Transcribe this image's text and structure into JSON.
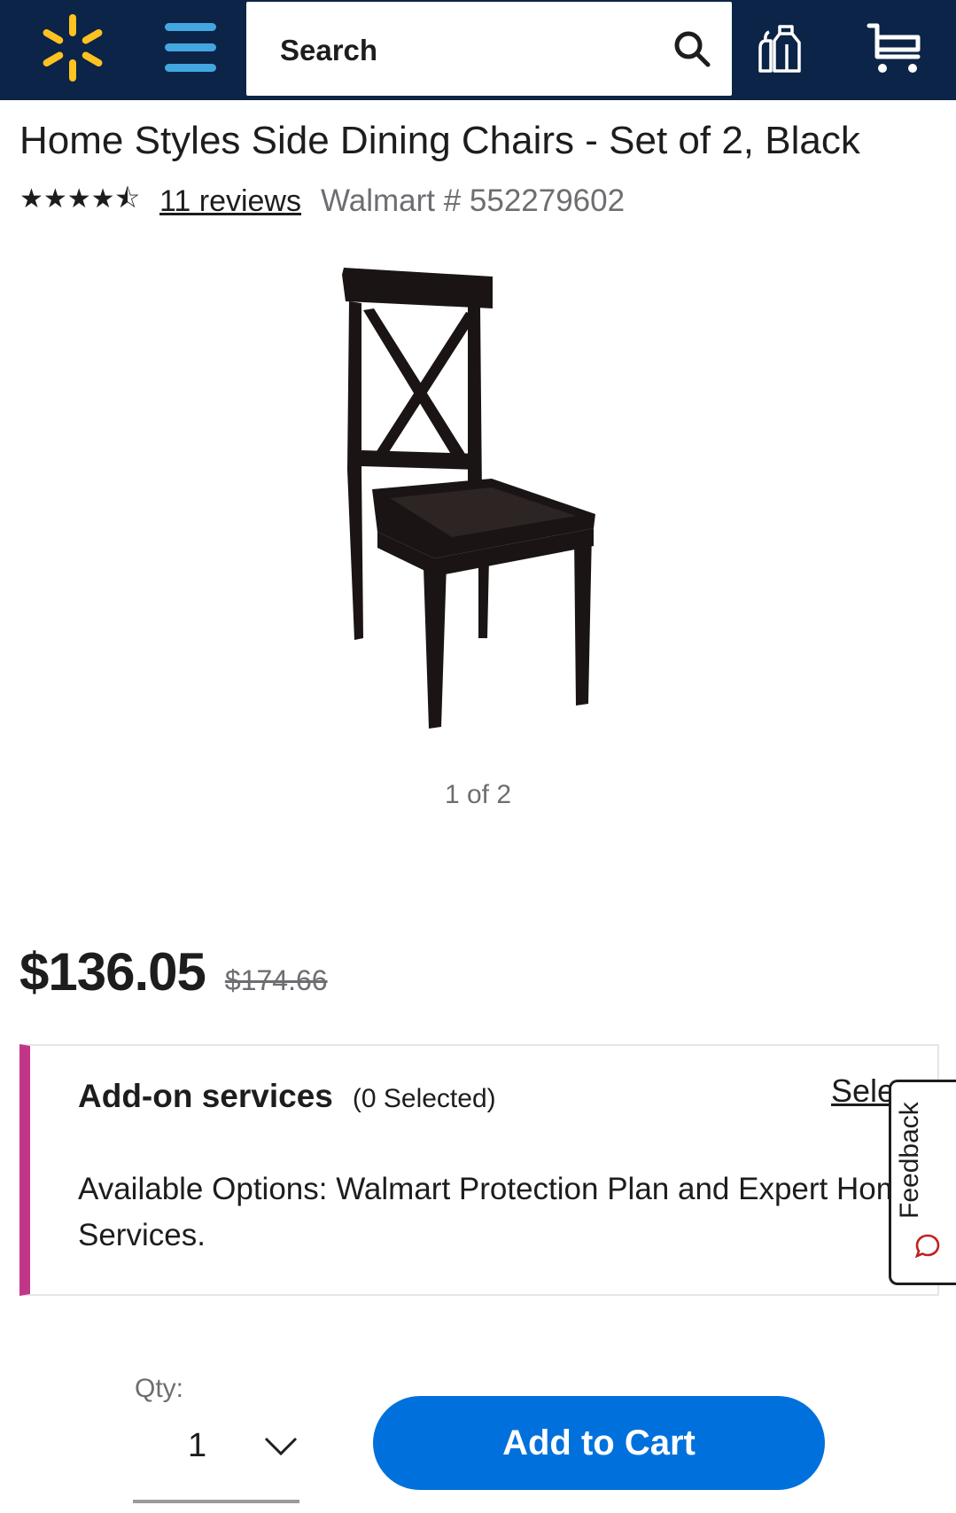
{
  "header": {
    "search_placeholder": "Search",
    "colors": {
      "background": "#0b2447",
      "spark": "#ffc220",
      "menu": "#42a7e1"
    },
    "icons": [
      "walmart-spark-icon",
      "menu-icon",
      "search-icon",
      "grocery-icon",
      "cart-icon"
    ]
  },
  "product": {
    "title": "Home Styles Side Dining Chairs - Set of 2, Black",
    "stars": "★★★★⯪",
    "rating_out_of_5": 4.5,
    "reviews": "11 reviews",
    "walmart_number": "Walmart # 552279602",
    "image_counter": "1 of 2"
  },
  "price": {
    "current": "$136.05",
    "was": "$174.66"
  },
  "addons": {
    "title": "Add-on services",
    "count": "(0 Selected)",
    "select": "Select",
    "description": "Available Options: Walmart Protection Plan and Expert Home Services.",
    "accent": "#c2368a"
  },
  "feedback": {
    "label": "Feedback"
  },
  "purchase": {
    "qty_label": "Qty:",
    "qty_value": "1",
    "add_to_cart": "Add to Cart",
    "button_color": "#0071dc"
  }
}
